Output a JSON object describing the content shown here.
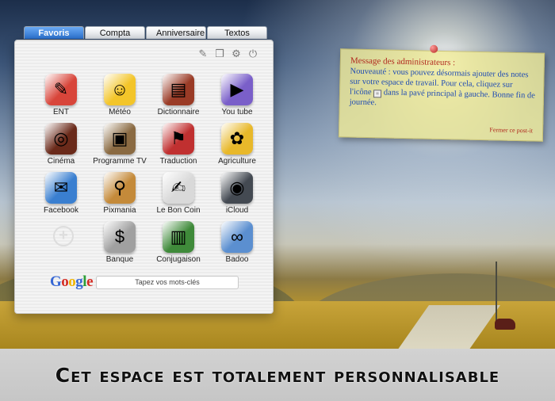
{
  "tabs": [
    {
      "label": "Favoris",
      "active": true
    },
    {
      "label": "Compta",
      "active": false
    },
    {
      "label": "Anniversaire",
      "active": false
    },
    {
      "label": "Textos",
      "active": false
    }
  ],
  "toolbar": {
    "icons": [
      "notes-icon",
      "scroll-icon",
      "gear-icon",
      "power-icon"
    ]
  },
  "apps": [
    {
      "label": "ENT",
      "icon": "ent-icon",
      "color": "#d8453a",
      "glyph": "✎"
    },
    {
      "label": "Météo",
      "icon": "weather-icon",
      "color": "#f3c52a",
      "glyph": "☺"
    },
    {
      "label": "Dictionnaire",
      "icon": "books-icon",
      "color": "#9a3b26",
      "glyph": "▤"
    },
    {
      "label": "You tube",
      "icon": "youtube-icon",
      "color": "#7a5fc9",
      "glyph": "▶"
    },
    {
      "label": "Cinéma",
      "icon": "film-reel-icon",
      "color": "#6a2a1a",
      "glyph": "◎"
    },
    {
      "label": "Programme TV",
      "icon": "tv-icon",
      "color": "#8a6a42",
      "glyph": "▣"
    },
    {
      "label": "Traduction",
      "icon": "flags-icon",
      "color": "#c03030",
      "glyph": "⚑"
    },
    {
      "label": "Agriculture",
      "icon": "bee-icon",
      "color": "#e8b82a",
      "glyph": "✿"
    },
    {
      "label": "Facebook",
      "icon": "facebook-icon",
      "color": "#3a7fd0",
      "glyph": "✉"
    },
    {
      "label": "Pixmania",
      "icon": "magnifier-icon",
      "color": "#c48a3a",
      "glyph": "⚲"
    },
    {
      "label": "Le Bon Coin",
      "icon": "document-pen-icon",
      "color": "#d9d9d9",
      "glyph": "✍"
    },
    {
      "label": "iCloud",
      "icon": "camera-icon",
      "color": "#444a52",
      "glyph": "◉"
    },
    {
      "label": "Banque",
      "icon": "coins-icon",
      "color": "#a0a0a0",
      "glyph": "$"
    },
    {
      "label": "Conjugaison",
      "icon": "book-icon",
      "color": "#3f8a3a",
      "glyph": "▥"
    },
    {
      "label": "Badoo",
      "icon": "chain-link-icon",
      "color": "#5b8fd0",
      "glyph": "∞"
    }
  ],
  "search": {
    "logo": [
      "G",
      "o",
      "o",
      "g",
      "l",
      "e"
    ],
    "placeholder": "Tapez vos mots-clés"
  },
  "postit": {
    "title": "Message des administrateurs :",
    "body_before": "Nouveauté : vous pouvez désormais ajouter des notes sur votre espace de travail. Pour cela, cliquez sur l'icône",
    "body_after": "dans la pavé principal à gauche. Bonne fin de journée.",
    "close_label": "Fermer ce post-it"
  },
  "banner": {
    "text": "Cet espace est totalement personnalisable"
  }
}
